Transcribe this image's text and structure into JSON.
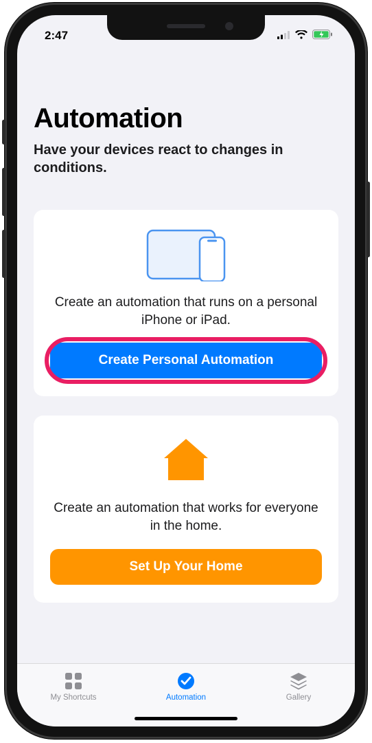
{
  "status": {
    "time": "2:47"
  },
  "header": {
    "title": "Automation",
    "subtitle": "Have your devices react to changes in conditions."
  },
  "personal_card": {
    "description": "Create an automation that runs on a personal iPhone or iPad.",
    "button_label": "Create Personal Automation"
  },
  "home_card": {
    "description": "Create an automation that works for everyone in the home.",
    "button_label": "Set Up Your Home"
  },
  "tabs": {
    "shortcuts": "My Shortcuts",
    "automation": "Automation",
    "gallery": "Gallery"
  },
  "colors": {
    "accent_blue": "#007aff",
    "accent_orange": "#ff9500",
    "highlight": "#e91e63"
  }
}
